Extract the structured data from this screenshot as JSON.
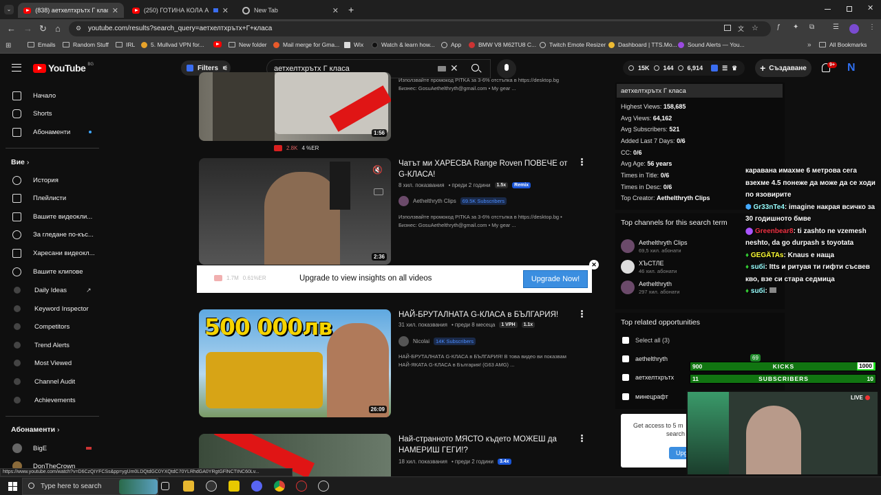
{
  "browser": {
    "tabs": [
      {
        "title": "(838) аетхелтхрътх Г класа - Yo",
        "active": true,
        "icon": "youtube-icon"
      },
      {
        "title": "(250) ГОТИНА КОЛА АВТО",
        "active": false,
        "icon": "youtube-icon"
      },
      {
        "title": "New Tab",
        "active": false,
        "icon": "chrome-icon"
      }
    ],
    "url": "youtube.com/results?search_query=аетхелтхрътх+Г+класа",
    "bookmarks": [
      "Emails",
      "Random Stuff",
      "IRL",
      "5. Mullvad VPN for...",
      "New folder",
      "Mail merge for Gma...",
      "Wix",
      "Watch & learn how...",
      "App",
      "BMW V8 M62TU8 C...",
      "Twitch Emote Resizer",
      "Dashboard | TTS.Mo...",
      "Sound Alerts — You..."
    ],
    "all_bookmarks": "All Bookmarks"
  },
  "header": {
    "logo_text": "YouTube",
    "logo_country": "BG",
    "filters_label": "Filters",
    "search_query": "аетхелтхрътх Г класа",
    "stats": {
      "views": "15K",
      "likes": "144",
      "comments": "6,914"
    },
    "create_label": "Създаване",
    "notifications": "9+",
    "avatar_letter": "N"
  },
  "sidebar": {
    "main": [
      {
        "label": "Начало",
        "icon": "home-icon"
      },
      {
        "label": "Shorts",
        "icon": "shorts-icon"
      },
      {
        "label": "Абонаменти",
        "icon": "subscriptions-icon"
      }
    ],
    "you_heading": "Вие",
    "you": [
      {
        "label": "История",
        "icon": "history-icon"
      },
      {
        "label": "Плейлисти",
        "icon": "playlist-icon"
      },
      {
        "label": "Вашите видеокли...",
        "icon": "videos-icon"
      },
      {
        "label": "За гледане по-къс...",
        "icon": "watch-later-icon"
      },
      {
        "label": "Харесани видеокл...",
        "icon": "like-icon"
      },
      {
        "label": "Вашите клипове",
        "icon": "clips-icon"
      }
    ],
    "ext": [
      {
        "label": "Daily Ideas"
      },
      {
        "label": "Keyword Inspector"
      },
      {
        "label": "Competitors"
      },
      {
        "label": "Trend Alerts"
      },
      {
        "label": "Most Viewed"
      },
      {
        "label": "Channel Audit"
      },
      {
        "label": "Achievements"
      }
    ],
    "subs_heading": "Абонаменти",
    "subs": [
      {
        "label": "BigE"
      },
      {
        "label": "DonTheCrown"
      }
    ]
  },
  "results": {
    "top_partial": {
      "desc": "Използвайте промокод PITKA за 3-6% отстъпка в https://desktop.bg",
      "business": "Бизнес: GosuAethelthryth@gmail.com • My gear ...",
      "duration": "1:56",
      "views_badge": "2.8K",
      "er": "4 %ER"
    },
    "video2": {
      "title": "Чатът ми ХАРЕСВА Range Roven ПОВЕЧЕ от G-КЛАСА!",
      "views": "8 хил. показвания",
      "age": "преди 2 години",
      "ratio": "1.5x",
      "remix": "Remix",
      "channel": "Aethelthryth Clips",
      "subs": "69.5K Subscribers",
      "desc": "Използвайте промокод PITKA за 3-6% отстъпка в https://desktop.bg •",
      "business": "Бизнес: GosuAethelthryth@gmail.com • My gear ...",
      "duration": "2:36"
    },
    "upgrade": {
      "views": "1.7M",
      "er": "0.61%ER",
      "text": "Upgrade to view insights on all videos",
      "button": "Upgrade Now!"
    },
    "video3": {
      "title": "НАЙ-БРУТАЛНАТА G-КЛАСА в БЪЛГАРИЯ!",
      "views": "31 хил. показвания",
      "age": "преди 8 месеца",
      "vph": "1 VPH",
      "ratio": "1.1x",
      "channel": "Nicolai",
      "subs": "14K Subscribers",
      "desc": "НАЙ-БРУТАЛНАТА G-КЛАСА в БЪЛГАРИЯ! В това видео ви показвам",
      "desc2": "НАЙ-ЯКАТА G-КЛАСА в България! (G63 AMG) ...",
      "thumb_text": "500 000лв",
      "duration": "26:09"
    },
    "video4": {
      "title": "Най-странното МЯСТО където МОЖЕШ да НАМЕРИШ ГЕГИ!?",
      "views": "18 хил. показвания",
      "age": "преди 2 години",
      "ratio": "3.4x"
    }
  },
  "panel": {
    "query": "аетхелтхрътх Г класа",
    "stats": [
      {
        "label": "Highest Views:",
        "value": "158,685"
      },
      {
        "label": "Avg Views:",
        "value": "64,162"
      },
      {
        "label": "Avg Subscribers:",
        "value": "521"
      },
      {
        "label": "Added Last 7 Days:",
        "value": "0/6"
      },
      {
        "label": "CC:",
        "value": "0/6"
      },
      {
        "label": "Avg Age:",
        "value": "56 years"
      },
      {
        "label": "Times in Title:",
        "value": "0/6"
      },
      {
        "label": "Times in Desc:",
        "value": "0/6"
      },
      {
        "label": "Top Creator:",
        "value": "Aethelthryth Clips"
      }
    ],
    "top_channels_title": "Top channels for this search term",
    "top_channels": [
      {
        "name": "Aethelthryth Clips",
        "subs": "69,5 хил. абонати"
      },
      {
        "name": "ХЪСТЛЕ",
        "subs": "46 хил. абонати"
      },
      {
        "name": "Aethelthryth",
        "subs": "297 хил. абонати"
      }
    ],
    "opps_title": "Top related opportunities",
    "select_all": "Select all (3)",
    "opps": [
      {
        "label": "aethelthryth",
        "score": "69"
      },
      {
        "label": "аетхелтхрътх"
      },
      {
        "label": "минецрафт"
      }
    ],
    "access_text": "Get access to 5 m",
    "access_text2": "search",
    "access_btn": "Upg"
  },
  "overlay": {
    "chat": [
      {
        "user": "",
        "msg": "каравана имахме 6 метрова сега взехме 4.5 понеже да може да се ходи по язовирите"
      },
      {
        "user": "Gr33nTe4",
        "msg": ": imagine накрая всичко за 30 годишното бмве"
      },
      {
        "user": "Greenbear8",
        "msg": ": ti zashto ne vzemesh neshto, da go durpash s toyotata"
      },
      {
        "user": "GEGÄTAs",
        "msg": ": Knaus е наща"
      },
      {
        "user": "suбi",
        "msg": ": Itts и ритуая ти гифти съсвев кво, взе си стара седмица"
      },
      {
        "user": "suбi",
        "msg": ":"
      }
    ],
    "kicks": {
      "current": "900",
      "label": "KICKS",
      "goal": "1000",
      "progress": 0.9
    },
    "subscribers": {
      "current": "11",
      "label": "SUBSCRIBERS",
      "goal": "10",
      "progress": 1.0
    },
    "live": "LIVE"
  },
  "status_url": "https://www.youtube.com/watch?v=D6CzQIYFCSs&pp=ygUm0LDQtdGC0YXQtdC70YLRhdGA0YRgtGFlNCTINC60Lv...",
  "taskbar": {
    "search_placeholder": "Type here to search"
  }
}
